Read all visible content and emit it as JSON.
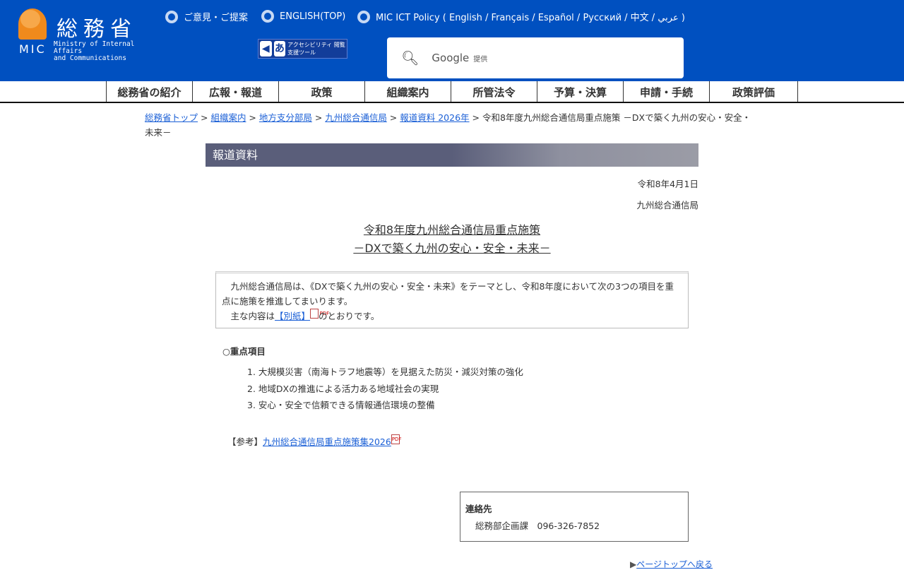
{
  "header": {
    "logo_kanji": "総務省",
    "logo_abbr": "MIC",
    "logo_en_1": "Ministry of Internal Affairs",
    "logo_en_2": "and Communications",
    "links": [
      "ご意見・ご提案",
      "ENGLISH(TOP)",
      "MIC ICT Policy ( English / Français / Español / Русский / 中文 / عربي )"
    ],
    "accessibility": "アクセシビリティ 閲覧支援ツール",
    "search_brand": "Google",
    "search_suffix": "提供"
  },
  "nav": [
    "総務省の紹介",
    "広報・報道",
    "政策",
    "組織案内",
    "所管法令",
    "予算・決算",
    "申請・手続",
    "政策評価"
  ],
  "breadcrumb": {
    "links": [
      "総務省トップ",
      "組織案内",
      "地方支分部局",
      "九州総合通信局",
      "報道資料 2026年"
    ],
    "current": "令和8年度九州総合通信局重点施策 －DXで築く九州の安心・安全・未来－"
  },
  "section_title": "報道資料",
  "date": "令和8年4月1日",
  "issuer": "九州総合通信局",
  "headline": [
    "令和8年度九州総合通信局重点施策",
    "－DXで築く九州の安心・安全・未来－"
  ],
  "intro": {
    "p1": "九州総合通信局は、《DXで築く九州の安心・安全・未来》をテーマとし、令和8年度において次の3つの項目を重点に施策を推進してまいります。",
    "p2_pre": "主な内容は",
    "p2_link": "【別紙】",
    "p2_post": "のとおりです。"
  },
  "points": {
    "title": "○重点項目",
    "items": [
      "1. 大規模災害（南海トラフ地震等）を見据えた防災・減災対策の強化",
      "2. 地域DXの推進による活力ある地域社会の実現",
      "3. 安心・安全で信頼できる情報通信環境の整備"
    ]
  },
  "reference": {
    "label": "【参考】",
    "link": "九州総合通信局重点施策集2026"
  },
  "contact": {
    "title": "連絡先",
    "dept": "総務部企画課",
    "phone": "096-326-7852"
  },
  "to_top": "ページトップへ戻る"
}
